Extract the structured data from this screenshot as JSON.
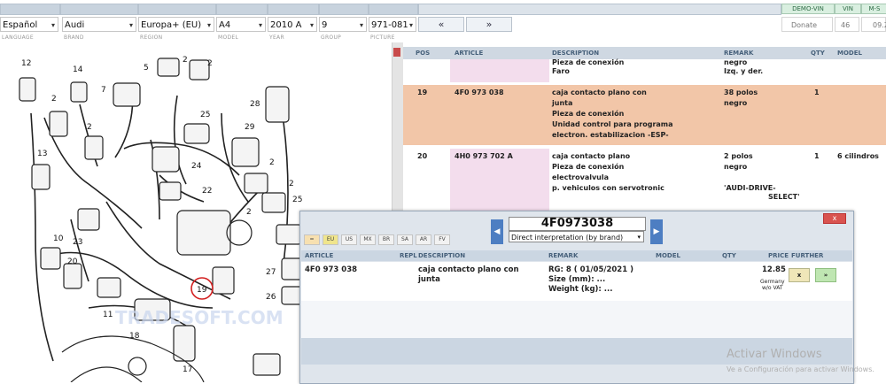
{
  "topbar": {
    "chips": [
      "DEMO-VIN",
      "VIN",
      "M-S"
    ]
  },
  "selectors": {
    "language": "Español",
    "brand": "Audi",
    "region": "Europa+ (EU)",
    "model": "A4",
    "year": "2010  A",
    "group": "9",
    "picture": "971-081",
    "prev_label": "«",
    "next_label": "»",
    "donate_label": "Donate",
    "counter": "46",
    "time": "09.2"
  },
  "labels": [
    "LANGUAGE",
    "BRAND",
    "REGION",
    "MODEL",
    "YEAR",
    "GROUP",
    "PICTURE"
  ],
  "diagram": {
    "callouts": [
      "12",
      "14",
      "5",
      "2",
      "2",
      "7",
      "2",
      "25",
      "13",
      "2",
      "24",
      "22",
      "28",
      "29",
      "2",
      "2",
      "2",
      "23",
      "10",
      "20",
      "19",
      "11",
      "18",
      "17",
      "27",
      "26",
      "25"
    ],
    "watermark": "TRADESOFT.COM"
  },
  "table": {
    "headers": [
      "POS",
      "ARTICLE",
      "DESCRIPTION",
      "REMARK",
      "QTY",
      "MODEL"
    ],
    "rows": [
      {
        "pos": "",
        "article": "",
        "description": [
          "Pieza de conexión",
          "Faro"
        ],
        "remark": [
          "negro",
          "Izq. y der."
        ],
        "qty": "",
        "model": ""
      },
      {
        "pos": "19",
        "article": "4F0 973 038",
        "description": [
          "caja contacto plano con",
          "junta",
          "Pieza de conexión",
          "Unidad control para programa",
          "electron. estabilizacion -ESP-"
        ],
        "remark": [
          "38 polos",
          "negro"
        ],
        "qty": "1",
        "model": ""
      },
      {
        "pos": "20",
        "article": "4H0 973 702 A",
        "description": [
          "caja contacto plano",
          "Pieza de conexión",
          "electrovalvula",
          "p. vehiculos con servotronic"
        ],
        "remark": [
          "2 polos",
          "negro",
          "",
          "'AUDI-DRIVE-",
          "SELECT'"
        ],
        "qty": "1",
        "model": "6 cilindros"
      }
    ]
  },
  "popup": {
    "search_value": "4F0973038",
    "mode_select": "Direct interpretation (by brand)",
    "close_label": "x",
    "flags": [
      "=",
      "EU",
      "US",
      "MX",
      "BR",
      "SA",
      "AR",
      "FV"
    ],
    "headers": [
      "ARTICLE",
      "REPL",
      "DESCRIPTION",
      "REMARK",
      "MODEL",
      "QTY",
      "PRICE",
      "FURTHER"
    ],
    "result": {
      "article": "4F0 973 038",
      "description": [
        "caja contacto plano con",
        "junta"
      ],
      "remark": [
        "RG: 8 ( 01/05/2021 )",
        "Size (mm): ...",
        "Weight (kg): ..."
      ],
      "price": "12.85",
      "price_note": [
        "Germany",
        "w/o VAT"
      ],
      "btn_x": "x",
      "btn_ok": "»"
    }
  },
  "windows_notice": {
    "title": "Activar Windows",
    "subtitle": "Ve a Configuración para activar Windows."
  },
  "colors": {
    "highlight_row": "#f2c6a8",
    "pink_column": "#f3dded",
    "header_blue": "#cfd8e2",
    "nav_blue": "#4d7ec2",
    "close_red": "#d9534f",
    "callout_red": "#d32020"
  }
}
